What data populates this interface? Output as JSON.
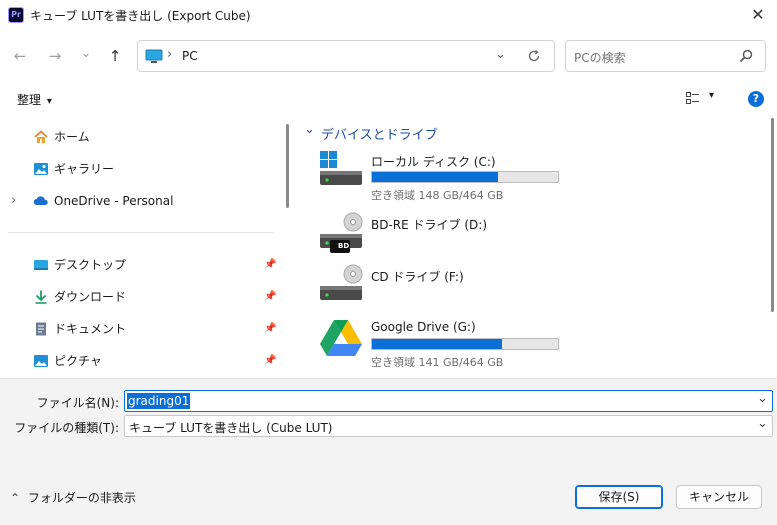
{
  "window": {
    "title": "キューブ LUTを書き出し (Export Cube)",
    "app_icon_text": "Pr",
    "close_glyph": "✕"
  },
  "nav": {
    "back": "←",
    "forward": "→",
    "recent": "⌄",
    "up": "↑"
  },
  "address": {
    "sep": "›",
    "location": "PC"
  },
  "search": {
    "placeholder": "PCの検索"
  },
  "toolbar": {
    "organize_label": "整理",
    "organize_arrow": "▾"
  },
  "sidebar": {
    "items": [
      {
        "label": "ホーム",
        "icon": "home-icon"
      },
      {
        "label": "ギャラリー",
        "icon": "gallery-icon"
      },
      {
        "label": "OneDrive - Personal",
        "icon": "cloud-icon",
        "expand": "›"
      },
      {
        "label": "デスクトップ",
        "icon": "desktop-icon",
        "pin": "📌"
      },
      {
        "label": "ダウンロード",
        "icon": "download-icon",
        "pin": "📌"
      },
      {
        "label": "ドキュメント",
        "icon": "document-icon",
        "pin": "📌"
      },
      {
        "label": "ピクチャ",
        "icon": "picture-icon",
        "pin": "📌"
      }
    ]
  },
  "content": {
    "group_title": "デバイスとドライブ",
    "group_chevron": "⌄",
    "drives": [
      {
        "name": "ローカル ディスク (C:)",
        "free": "空き領域 148 GB/464 GB",
        "used_fraction": 0.68,
        "icon": "windows-drive-icon"
      },
      {
        "name": "BD-RE ドライブ (D:)",
        "free": "",
        "icon": "bd-drive-icon",
        "badge": "BD"
      },
      {
        "name": "CD ドライブ (F:)",
        "free": "",
        "icon": "cd-drive-icon"
      },
      {
        "name": "Google Drive (G:)",
        "free": "空き領域 141 GB/464 GB",
        "used_fraction": 0.7,
        "icon": "google-drive-icon"
      }
    ]
  },
  "form": {
    "filename_label": "ファイル名(N):",
    "filename_value": "grading01",
    "filetype_label": "ファイルの種類(T):",
    "filetype_value": "キューブ LUTを書き出し (Cube LUT)",
    "dropdown_glyph": "⌄"
  },
  "footer": {
    "hide_folders_label": "フォルダーの非表示",
    "hide_folders_glyph": "⌃",
    "save_label": "保存(S)",
    "cancel_label": "キャンセル"
  },
  "colors": {
    "accent": "#0a6fd6",
    "selection": "#0a6fd6"
  }
}
